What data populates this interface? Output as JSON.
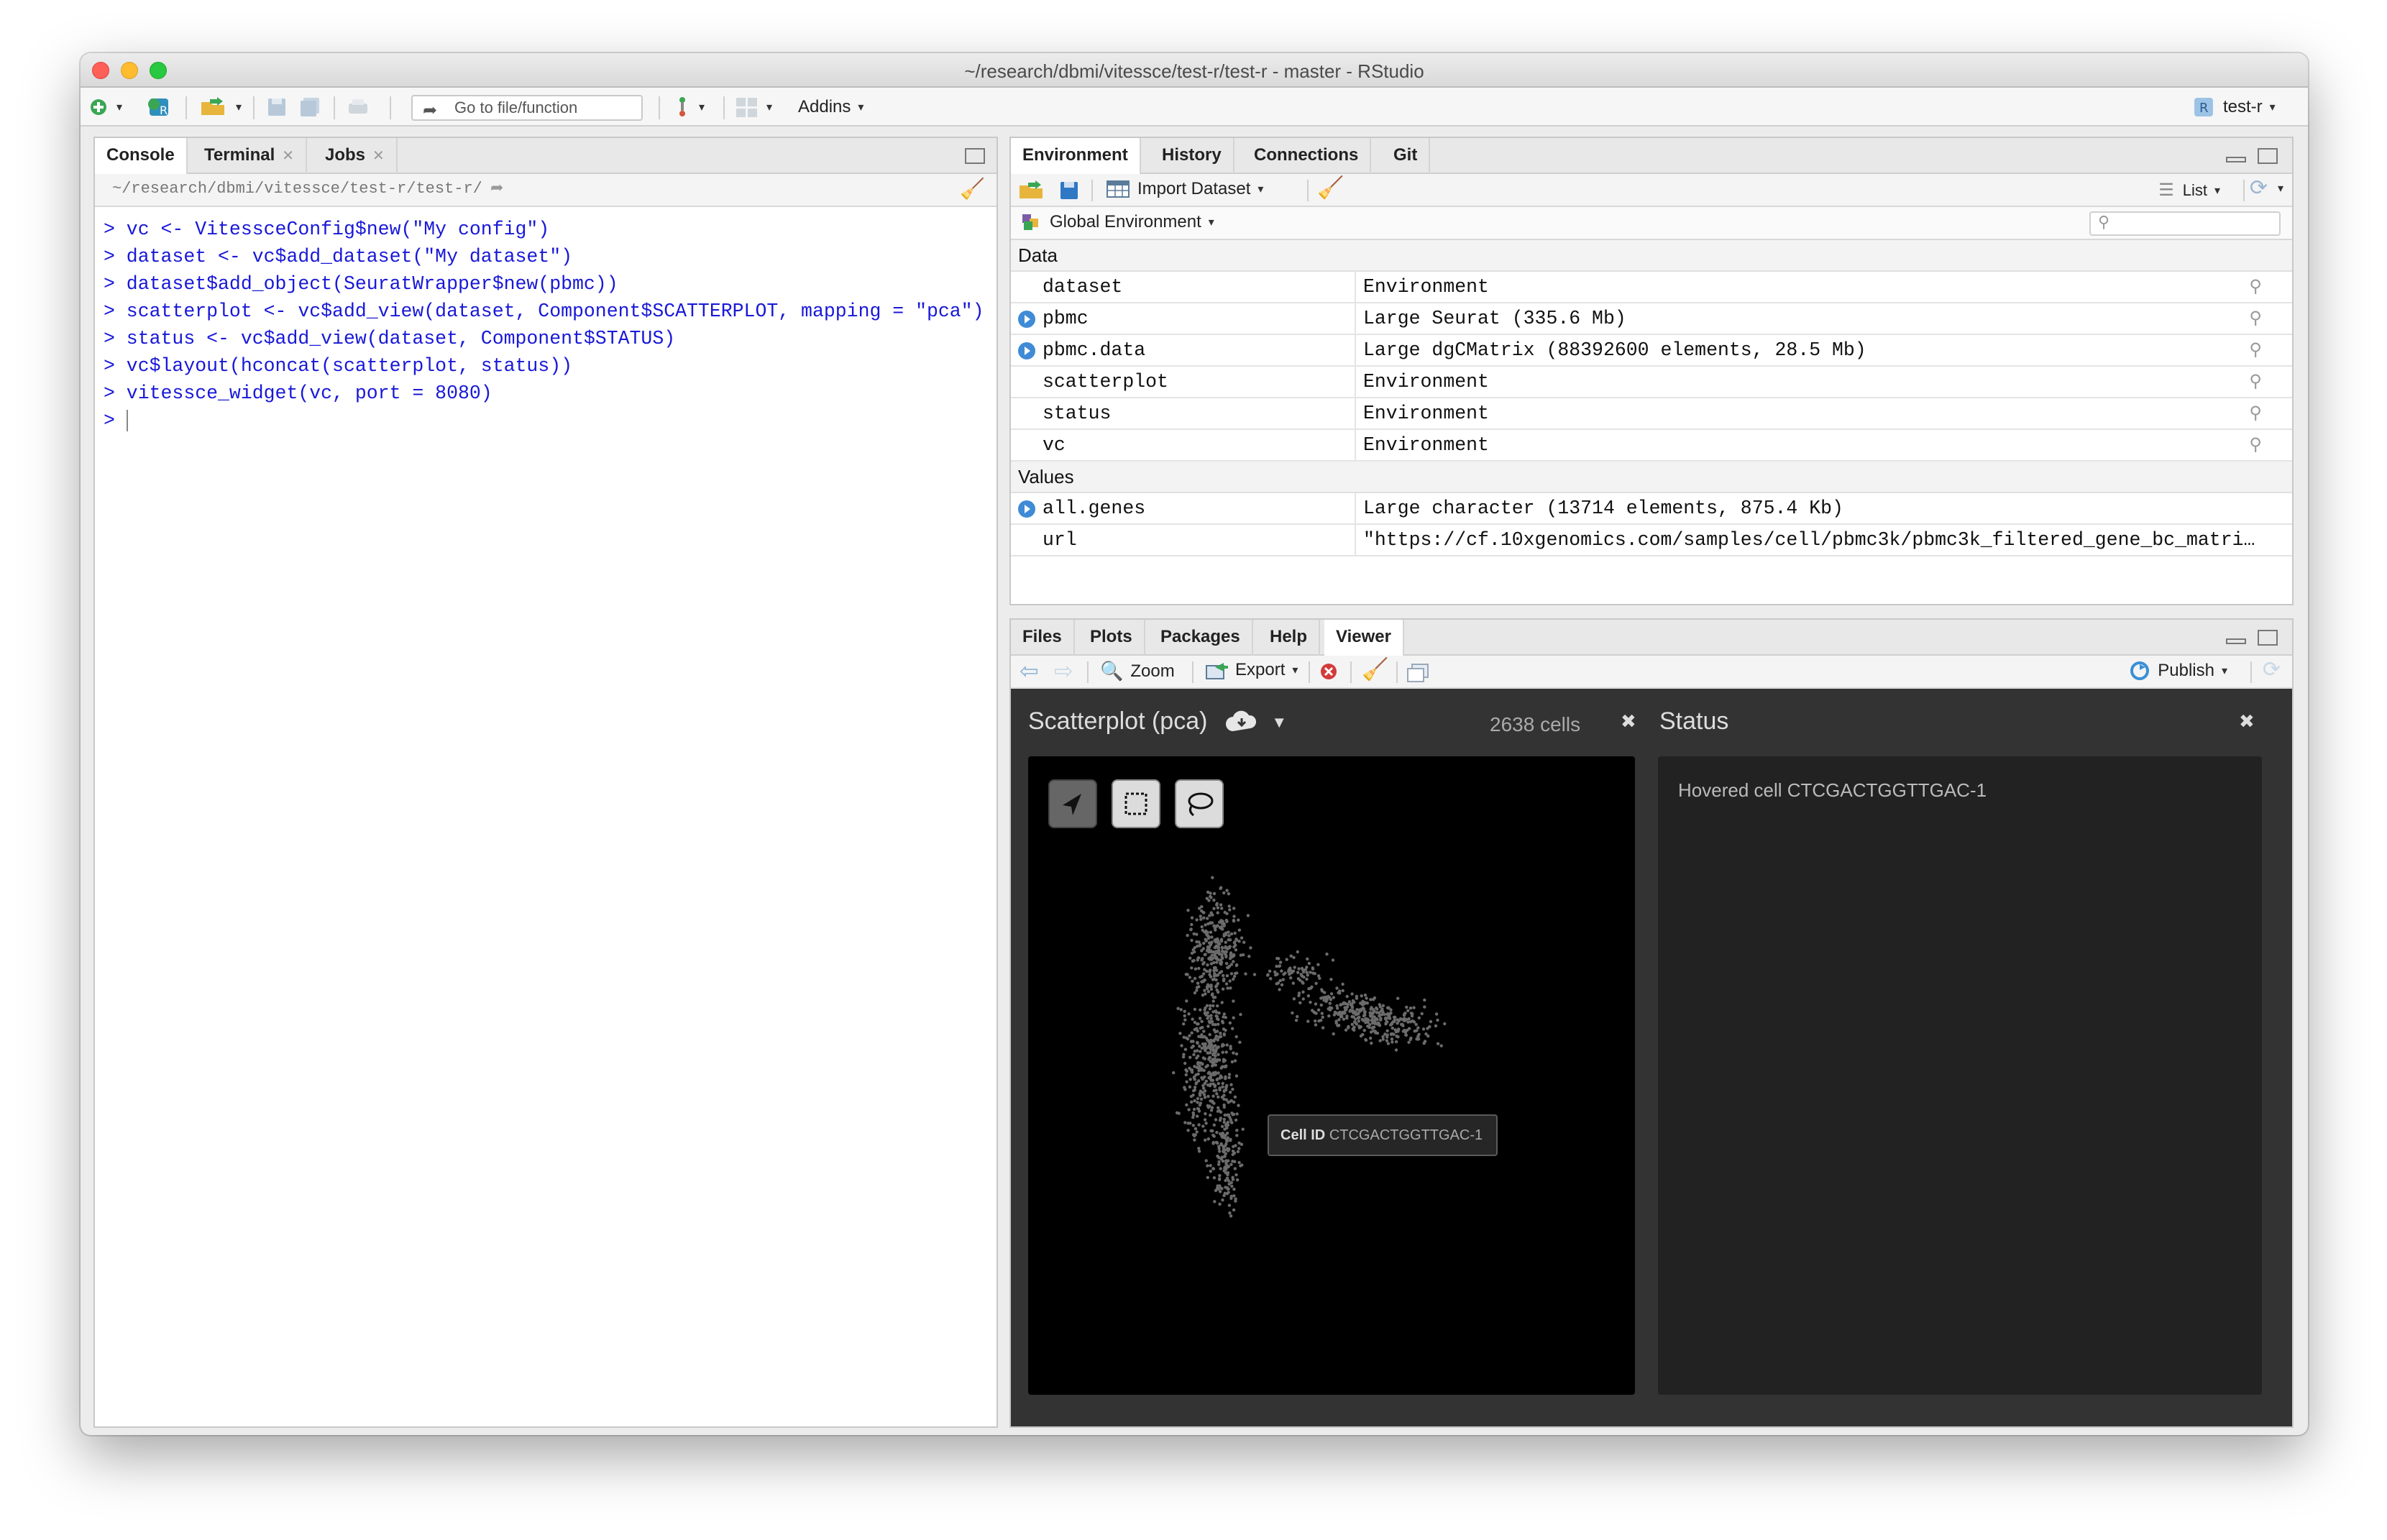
{
  "window": {
    "title": "~/research/dbmi/vitessce/test-r/test-r - master - RStudio"
  },
  "toolbar": {
    "goto_placeholder": "Go to file/function",
    "addins_label": "Addins",
    "project_label": "test-r"
  },
  "console_pane": {
    "tabs": [
      {
        "label": "Console",
        "closable": false
      },
      {
        "label": "Terminal",
        "closable": true
      },
      {
        "label": "Jobs",
        "closable": true
      }
    ],
    "working_dir": "~/research/dbmi/vitessce/test-r/test-r/",
    "lines": [
      "> vc <- VitessceConfig$new(\"My config\")",
      "> dataset <- vc$add_dataset(\"My dataset\")",
      "> dataset$add_object(SeuratWrapper$new(pbmc))",
      "> scatterplot <- vc$add_view(dataset, Component$SCATTERPLOT, mapping = \"pca\")",
      "> status <- vc$add_view(dataset, Component$STATUS)",
      "> vc$layout(hconcat(scatterplot, status))",
      "> vitessce_widget(vc, port = 8080)",
      "> "
    ]
  },
  "env_pane": {
    "tabs": [
      "Environment",
      "History",
      "Connections",
      "Git"
    ],
    "import_dataset_label": "Import Dataset",
    "list_label": "List",
    "scope_label": "Global Environment",
    "data_section": "Data",
    "values_section": "Values",
    "data_rows": [
      {
        "name": "dataset",
        "value": "Environment",
        "expandable": false
      },
      {
        "name": "pbmc",
        "value": "Large Seurat (335.6 Mb)",
        "expandable": true
      },
      {
        "name": "pbmc.data",
        "value": "Large dgCMatrix (88392600 elements, 28.5 Mb)",
        "expandable": true
      },
      {
        "name": "scatterplot",
        "value": "Environment",
        "expandable": false
      },
      {
        "name": "status",
        "value": "Environment",
        "expandable": false
      },
      {
        "name": "vc",
        "value": "Environment",
        "expandable": false
      }
    ],
    "value_rows": [
      {
        "name": "all.genes",
        "value": "Large character (13714 elements, 875.4 Kb)",
        "expandable": true
      },
      {
        "name": "url",
        "value": "\"https://cf.10xgenomics.com/samples/cell/pbmc3k/pbmc3k_filtered_gene_bc_matri…",
        "expandable": false
      }
    ]
  },
  "viewer_pane": {
    "tabs": [
      "Files",
      "Plots",
      "Packages",
      "Help",
      "Viewer"
    ],
    "zoom_label": "Zoom",
    "export_label": "Export",
    "publish_label": "Publish",
    "scatter_title": "Scatterplot (pca)",
    "cell_count": "2638 cells",
    "status_title": "Status",
    "status_text": "Hovered cell CTCGACTGGTTGAC-1",
    "tooltip_label": "Cell ID",
    "tooltip_value": "CTCGACTGGTTGAC-1",
    "colors": {
      "background": "#333333",
      "card": "#000000",
      "status_card": "#222222",
      "points": "#6b6b6b"
    }
  }
}
